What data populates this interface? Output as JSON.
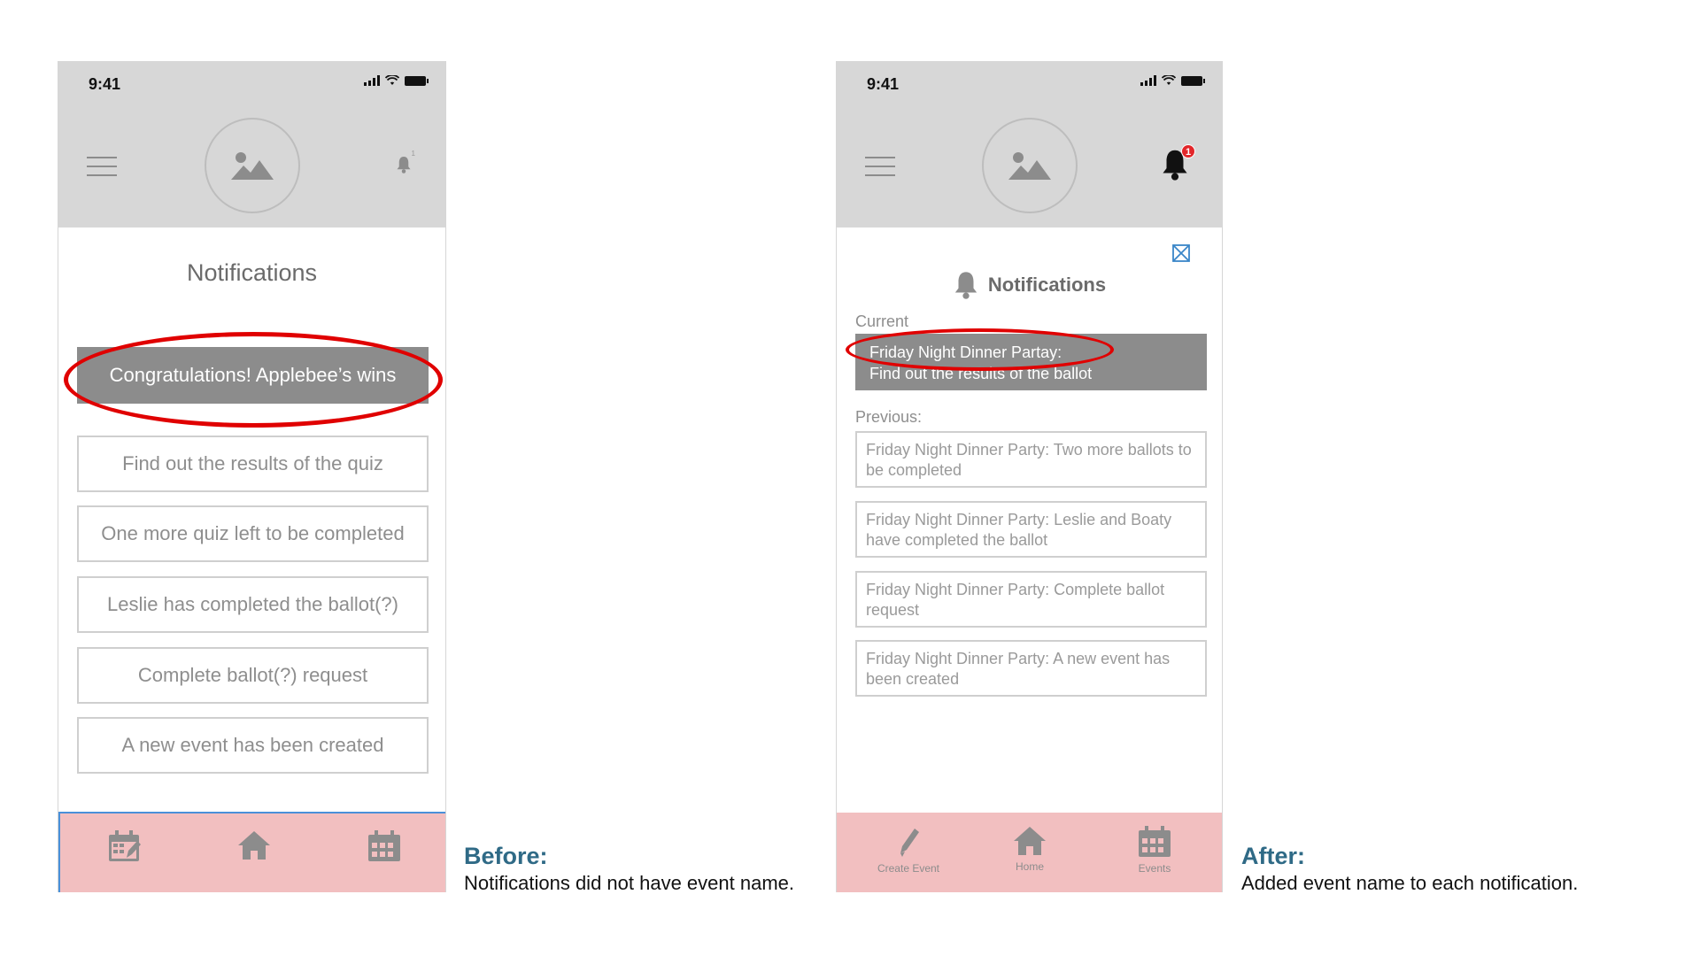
{
  "before": {
    "status_time": "9:41",
    "title": "Notifications",
    "highlighted": "Congratulations! Applebee’s wins",
    "items": [
      "Find out the results of the quiz",
      "One more quiz left to be completed",
      "Leslie has completed the ballot(?)",
      "Complete ballot(?) request",
      "A new event has been created"
    ],
    "badge_small": "1"
  },
  "before_caption": {
    "heading": "Before:",
    "text": "Notifications did not have event name."
  },
  "after": {
    "status_time": "9:41",
    "badge": "1",
    "title": "Notifications",
    "current_label": "Current",
    "current_line1": "Friday Night Dinner Partay:",
    "current_line2": "Find out the results of the ballot",
    "previous_label": "Previous:",
    "previous_items": [
      "Friday Night Dinner Party: Two more ballots to be completed",
      "Friday Night Dinner Party: Leslie and Boaty have completed the ballot",
      "Friday Night Dinner Party: Complete ballot request",
      "Friday Night Dinner Party: A new event has been created"
    ],
    "tabs": {
      "create": "Create Event",
      "home": "Home",
      "events": "Events"
    }
  },
  "after_caption": {
    "heading": "After:",
    "text": "Added event name to each notification."
  },
  "colors": {
    "header_gray": "#d7d7d7",
    "tabbar_pink": "#f2bfc0",
    "highlight_red": "#e00000",
    "caption_blue": "#2f6a86"
  }
}
